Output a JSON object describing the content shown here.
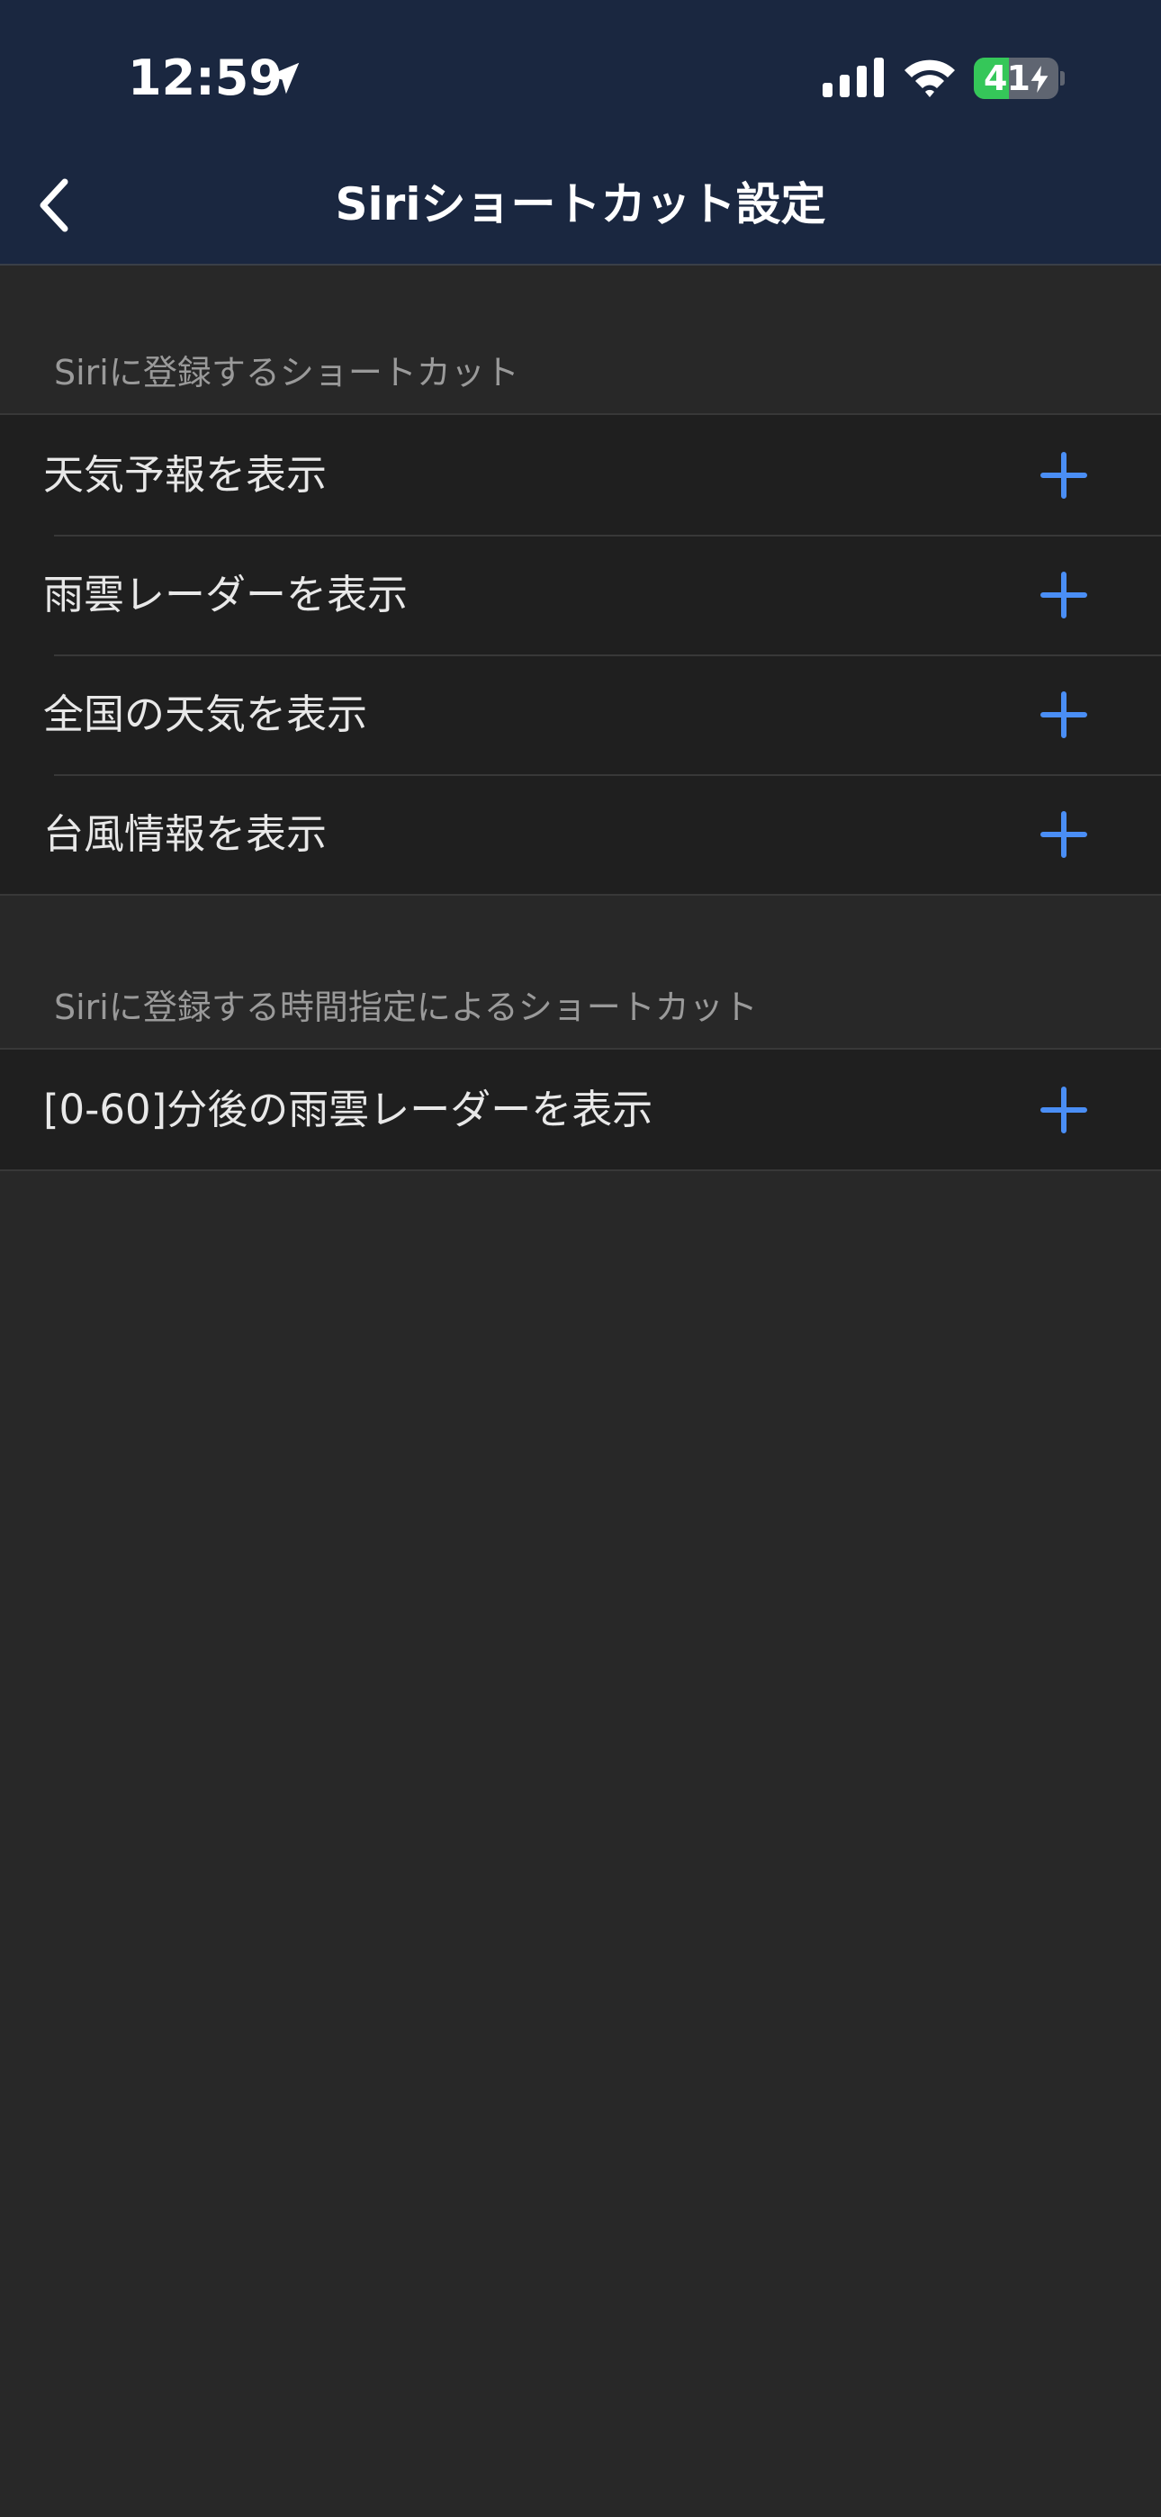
{
  "status_bar": {
    "time": "12:59",
    "battery_percent": "41",
    "battery_level": 0.41,
    "location_icon": "location-arrow-icon",
    "signal_icon": "cellular-signal-icon",
    "wifi_icon": "wifi-icon",
    "charging_icon": "bolt-icon"
  },
  "nav": {
    "title": "Siriショートカット設定",
    "back_icon": "chevron-left-icon"
  },
  "colors": {
    "header_background": "#1a2740",
    "page_background": "#282828",
    "row_background": "#1f1f1f",
    "accent_plus": "#4a8ef5",
    "battery_green": "#35c759"
  },
  "sections": [
    {
      "header": "Siriに登録するショートカット",
      "items": [
        {
          "label": "天気予報を表示",
          "action_icon": "plus-icon"
        },
        {
          "label": "雨雲レーダーを表示",
          "action_icon": "plus-icon"
        },
        {
          "label": "全国の天気を表示",
          "action_icon": "plus-icon"
        },
        {
          "label": "台風情報を表示",
          "action_icon": "plus-icon"
        }
      ]
    },
    {
      "header": "Siriに登録する時間指定によるショートカット",
      "items": [
        {
          "label": "[0-60]分後の雨雲レーダーを表示",
          "action_icon": "plus-icon"
        }
      ]
    }
  ]
}
